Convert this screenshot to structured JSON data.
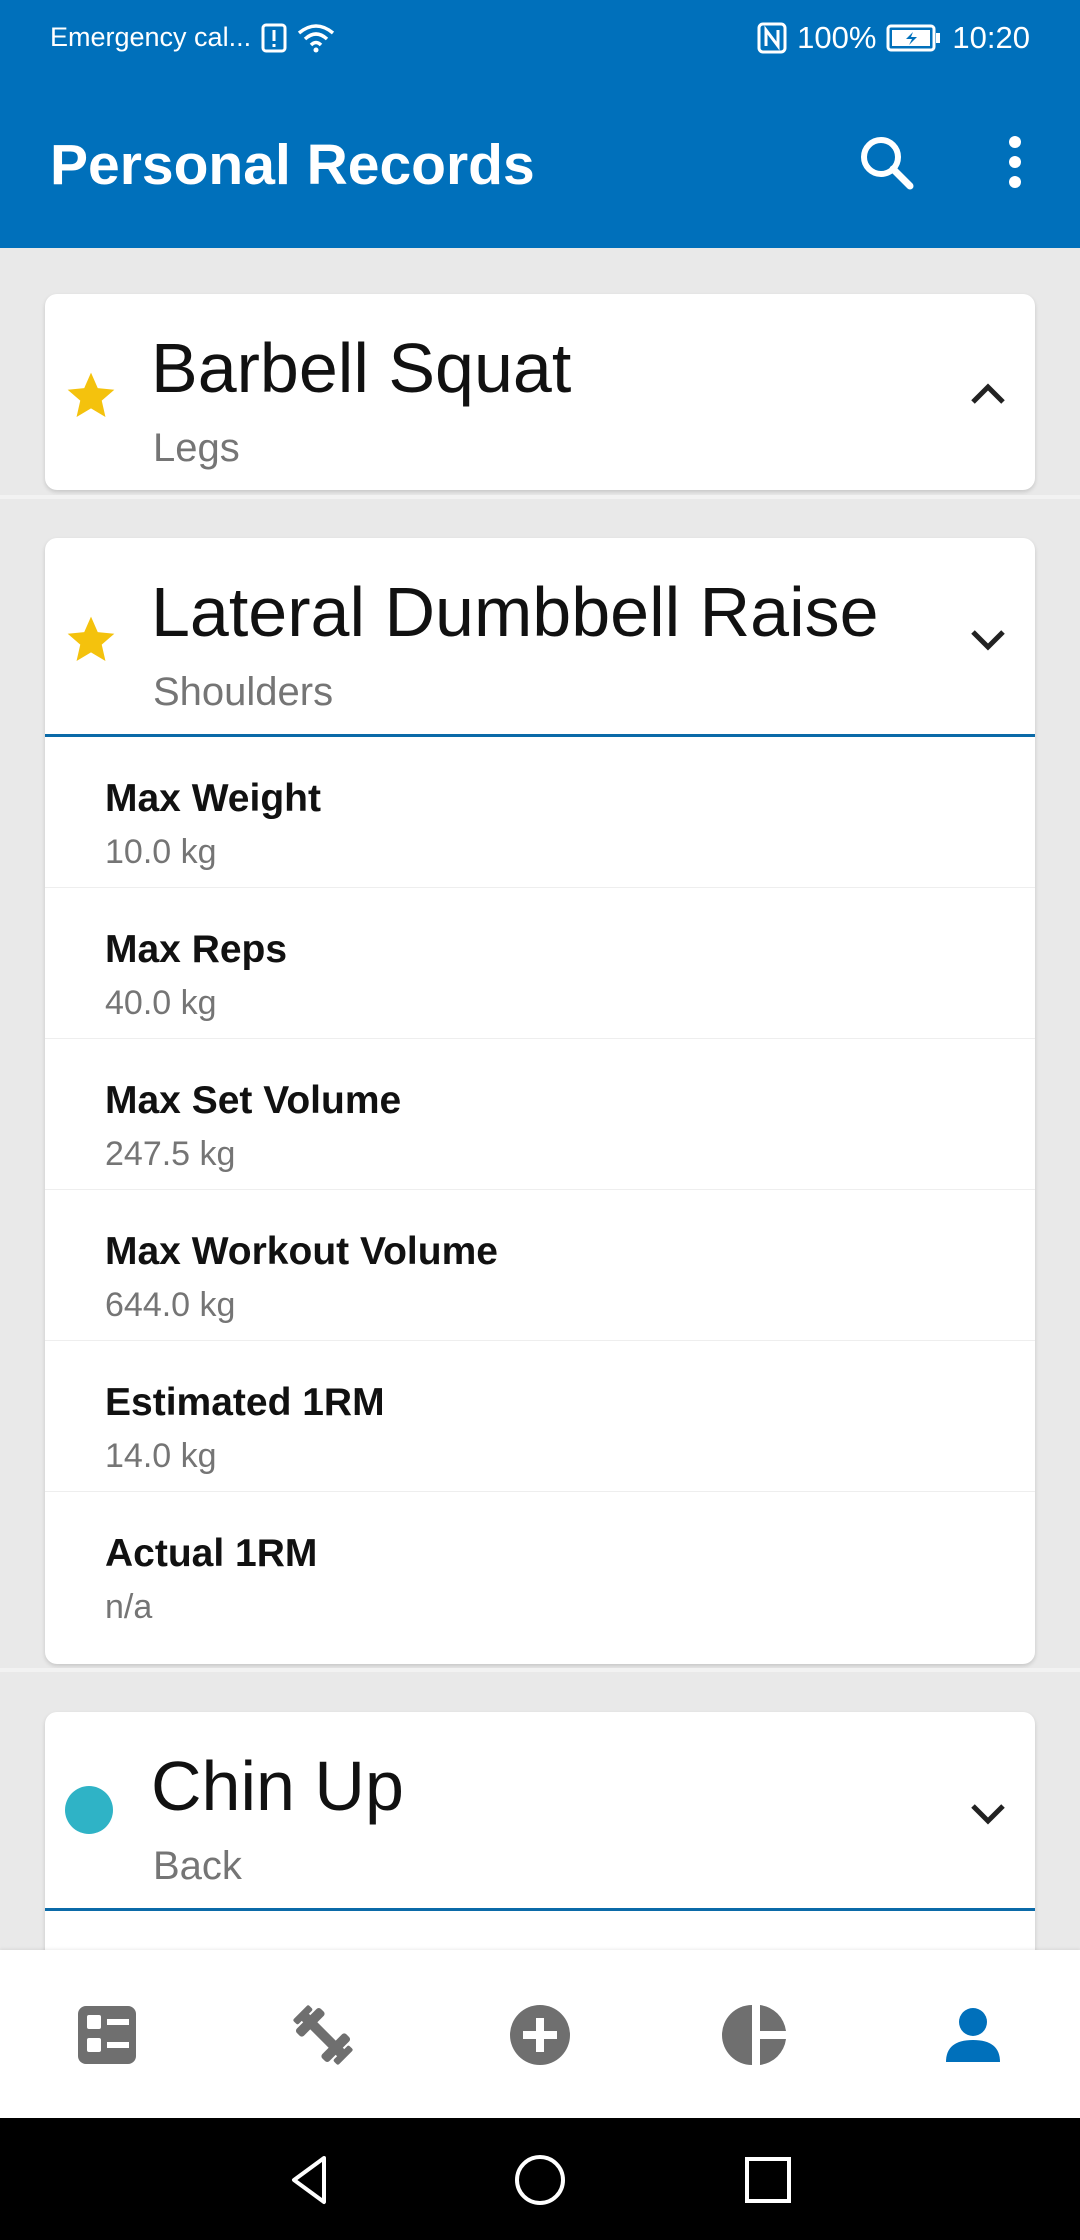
{
  "status_bar": {
    "left_text": "Emergency cal...",
    "battery": "100%",
    "time": "10:20"
  },
  "app_bar": {
    "title": "Personal Records",
    "search_icon": "search-icon",
    "more_icon": "more-vert-icon"
  },
  "cards": [
    {
      "name": "Barbell Squat",
      "category": "Legs",
      "marker": "star",
      "marker_color": "#f4c20d",
      "expanded": false
    },
    {
      "name": "Lateral Dumbbell Raise",
      "category": "Shoulders",
      "marker": "star",
      "marker_color": "#f4c20d",
      "expanded": true,
      "records": [
        {
          "label": "Max Weight",
          "value": "10.0 kg"
        },
        {
          "label": "Max Reps",
          "value": "40.0 kg"
        },
        {
          "label": "Max Set Volume",
          "value": "247.5 kg"
        },
        {
          "label": "Max Workout Volume",
          "value": "644.0 kg"
        },
        {
          "label": "Estimated 1RM",
          "value": "14.0 kg"
        },
        {
          "label": "Actual 1RM",
          "value": "n/a"
        }
      ]
    },
    {
      "name": "Chin Up",
      "category": "Back",
      "marker": "dot",
      "marker_color": "#2fb3c6",
      "expanded": true
    }
  ],
  "bottom_nav": [
    {
      "icon": "dashboard-icon",
      "active": false
    },
    {
      "icon": "dumbbell-icon",
      "active": false
    },
    {
      "icon": "add-circle-icon",
      "active": false
    },
    {
      "icon": "pie-chart-icon",
      "active": false
    },
    {
      "icon": "person-icon",
      "active": true
    }
  ],
  "colors": {
    "primary": "#0070bb",
    "accent_blue": "#0b6aa8",
    "star": "#f4c20d",
    "dot": "#2fb3c6",
    "nav_inactive": "#6f6f6f"
  }
}
